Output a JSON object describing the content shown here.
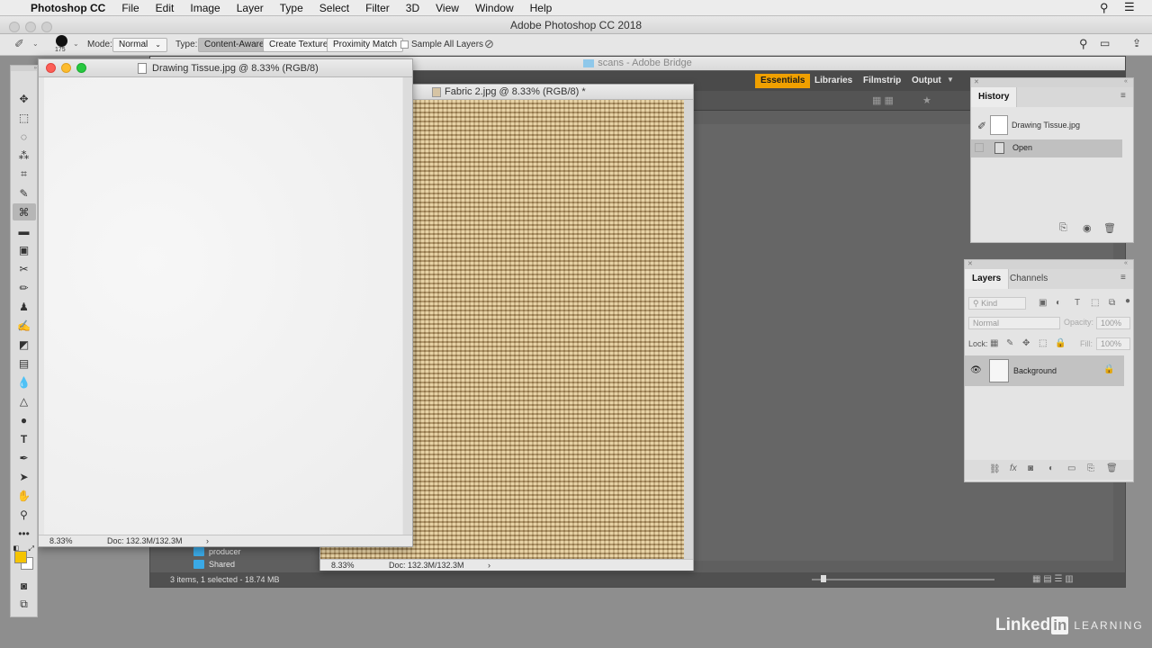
{
  "menubar": {
    "app": "Photoshop CC",
    "items": [
      "File",
      "Edit",
      "Image",
      "Layer",
      "Type",
      "Select",
      "Filter",
      "3D",
      "View",
      "Window",
      "Help"
    ]
  },
  "window": {
    "title": "Adobe Photoshop CC 2018"
  },
  "options": {
    "brush_size": "175",
    "mode_label": "Mode:",
    "mode_value": "Normal",
    "type_label": "Type:",
    "type_buttons": [
      "Content-Aware",
      "Create Texture",
      "Proximity Match"
    ],
    "sample_all_layers": "Sample All Layers"
  },
  "bridge": {
    "title": "scans - Adobe Bridge",
    "workspaces": [
      "Essentials",
      "Libraries",
      "Filmstrip",
      "Output"
    ],
    "folders": [
      "producer",
      "Shared"
    ],
    "status": "3 items, 1 selected - 18.74 MB"
  },
  "docs": {
    "drawing": {
      "title": "Drawing Tissue.jpg @ 8.33% (RGB/8)",
      "zoom": "8.33%",
      "doc": "Doc: 132.3M/132.3M"
    },
    "fabric": {
      "title": "Fabric 2.jpg @ 8.33% (RGB/8) *",
      "zoom": "8.33%",
      "doc": "Doc: 132.3M/132.3M"
    }
  },
  "history": {
    "tab": "History",
    "snapshot": "Drawing Tissue.jpg",
    "open": "Open"
  },
  "layers": {
    "tabs": [
      "Layers",
      "Channels"
    ],
    "kind": "Kind",
    "blend": "Normal",
    "opacity_label": "Opacity:",
    "opacity_value": "100%",
    "lock_label": "Lock:",
    "fill_label": "Fill:",
    "fill_value": "100%",
    "layer_name": "Background"
  },
  "colors": {
    "foreground": "#f5c400",
    "background": "#ffffff",
    "essentials_accent": "#f0a000"
  },
  "brand": {
    "name1": "Linked",
    "name2": "in",
    "learning": "LEARNING"
  }
}
